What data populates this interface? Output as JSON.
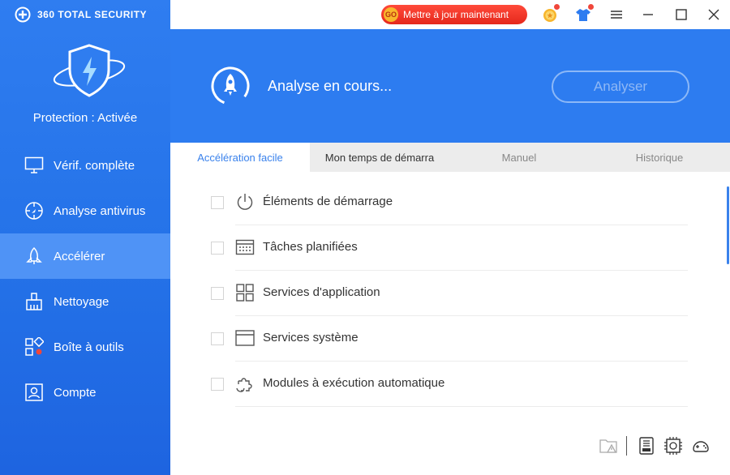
{
  "app": {
    "brand": "360 TOTAL SECURITY"
  },
  "sidebar": {
    "protection_status": "Protection : Activée",
    "items": [
      {
        "label": "Vérif. complète",
        "icon": "monitor-icon",
        "active": false
      },
      {
        "label": "Analyse antivirus",
        "icon": "virus-scan-icon",
        "active": false
      },
      {
        "label": "Accélérer",
        "icon": "rocket-icon",
        "active": true
      },
      {
        "label": "Nettoyage",
        "icon": "broom-icon",
        "active": false
      },
      {
        "label": "Boîte à outils",
        "icon": "toolbox-icon",
        "active": false
      },
      {
        "label": "Compte",
        "icon": "account-icon",
        "active": false
      }
    ]
  },
  "titlebar": {
    "update_badge": "GO",
    "update_label": "Mettre à jour maintenant"
  },
  "header": {
    "scan_status": "Analyse en cours...",
    "scan_button": "Analyser"
  },
  "tabs": [
    {
      "label": "Accélération facile",
      "active": true
    },
    {
      "label": "Mon temps de démarra",
      "active": false
    },
    {
      "label": "Manuel",
      "active": false
    },
    {
      "label": "Historique",
      "active": false
    }
  ],
  "items": [
    {
      "label": "Éléments de démarrage",
      "icon": "power-icon",
      "checked": false
    },
    {
      "label": "Tâches planifiées",
      "icon": "calendar-icon",
      "checked": false
    },
    {
      "label": "Services d'application",
      "icon": "grid-icon",
      "checked": false
    },
    {
      "label": "Services système",
      "icon": "window-icon",
      "checked": false
    },
    {
      "label": "Modules à exécution automatique",
      "icon": "puzzle-refresh-icon",
      "checked": false
    }
  ],
  "colors": {
    "accent": "#2d7cf0",
    "sidebar_active": "#4f93f6",
    "update_button": "#e5281c",
    "tab_active_text": "#3a82ec"
  }
}
